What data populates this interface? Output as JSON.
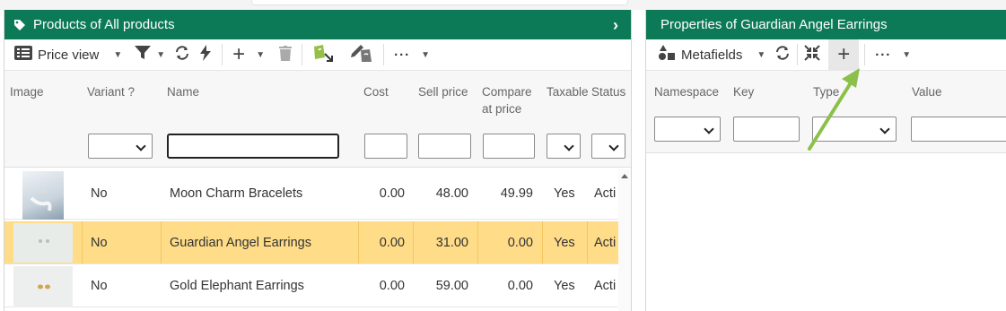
{
  "colors": {
    "header_green": "#0d7a57",
    "selected_row": "#fedc88",
    "arrow_green": "#8cc04a"
  },
  "left_panel": {
    "title": "Products of All products",
    "toolbar": {
      "view_label": "Price view",
      "icons": [
        "list-icon",
        "filter-icon",
        "refresh-icon",
        "bolt-icon",
        "plus-icon",
        "trash-icon",
        "shopify-export-icon",
        "shopify-edit-icon",
        "more-icon"
      ]
    },
    "columns": [
      "Image",
      "Variant ?",
      "Name",
      "Cost",
      "Sell price",
      "Compare at price",
      "Taxable",
      "Status"
    ],
    "rows": [
      {
        "variant": "No",
        "name": "Moon Charm Bracelets",
        "cost": "0.00",
        "sell": "48.00",
        "compare": "49.99",
        "taxable": "Yes",
        "status": "Acti",
        "selected": false
      },
      {
        "variant": "No",
        "name": "Guardian Angel Earrings",
        "cost": "0.00",
        "sell": "31.00",
        "compare": "0.00",
        "taxable": "Yes",
        "status": "Acti",
        "selected": true
      },
      {
        "variant": "No",
        "name": "Gold Elephant Earrings",
        "cost": "0.00",
        "sell": "59.00",
        "compare": "0.00",
        "taxable": "Yes",
        "status": "Acti",
        "selected": false
      }
    ]
  },
  "right_panel": {
    "title": "Properties of Guardian Angel Earrings",
    "toolbar": {
      "view_label": "Metafields",
      "icons": [
        "shapes-icon",
        "refresh-icon",
        "collapse-icon",
        "plus-icon",
        "more-icon"
      ]
    },
    "columns": [
      "Namespace",
      "Key",
      "Type",
      "Value"
    ]
  }
}
